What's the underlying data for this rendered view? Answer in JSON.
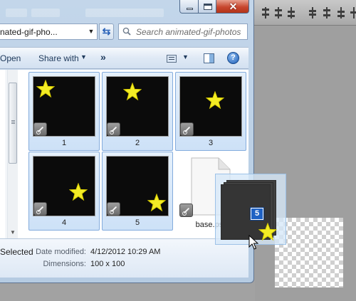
{
  "explorer": {
    "address": "nated-gif-pho...",
    "search_placeholder": "Search animated-gif-photos",
    "toolbar": {
      "open_label": "Open",
      "share_label": "Share with",
      "more_label": "»"
    },
    "help_label": "?",
    "files": [
      {
        "label": "1",
        "selected": true
      },
      {
        "label": "2",
        "selected": true
      },
      {
        "label": "3",
        "selected": true
      },
      {
        "label": "4",
        "selected": true
      },
      {
        "label": "5",
        "selected": true
      },
      {
        "label": "base.psd",
        "selected": false
      }
    ],
    "details": {
      "selection_text": "Selected",
      "date_modified_label": "Date modified:",
      "date_modified_value": "4/12/2012 10:29 AM",
      "dimensions_label": "Dimensions:",
      "dimensions_value": "100 x 100"
    }
  },
  "drag": {
    "count_badge": "5"
  },
  "icons": [
    "search-icon",
    "refresh-icon",
    "view-icon",
    "preview-pane-icon",
    "help-icon",
    "shortcut-link-icon",
    "star-icon",
    "psd-file-icon",
    "cursor-icon"
  ],
  "colors": {
    "star": "#f3ec26",
    "selection": "#cde1f7",
    "close_button": "#c7462e",
    "badge": "#1f62c4"
  }
}
